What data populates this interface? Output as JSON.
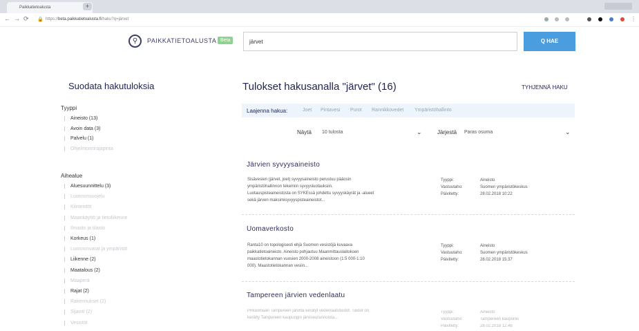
{
  "browser": {
    "tab_title": "Paikkatietoalusta",
    "url_host": "beta.paikkatietoalusta.fi",
    "url_prefix": "https://",
    "url_path": "/haku?q=järvet"
  },
  "header": {
    "logo_text": "PAIKKATIETOALUSTA",
    "beta_label": "Beta",
    "search_value": "järvet",
    "search_button": "Q HAE"
  },
  "filters": {
    "title": "Suodata hakutuloksia",
    "type_group": {
      "label": "Tyyppi",
      "items": [
        {
          "label": "Aineisto (13)",
          "faded": false
        },
        {
          "label": "Avoin data (3)",
          "faded": false
        },
        {
          "label": "Palvelu (1)",
          "faded": false
        },
        {
          "label": "Ohjelmointirajapinta",
          "faded": true
        }
      ]
    },
    "topic_group": {
      "label": "Aihealue",
      "items": [
        {
          "label": "Aluesuunnittelu (3)",
          "faded": false
        },
        {
          "label": "Luonnonsuojelu",
          "faded": true
        },
        {
          "label": "Kiinteistöt",
          "faded": true
        },
        {
          "label": "Maankäyttö ja tietoliikenne",
          "faded": true
        },
        {
          "label": "Ilmasto ja tilasto",
          "faded": true
        },
        {
          "label": "Korkeus (1)",
          "faded": false
        },
        {
          "label": "Luonnonvarat ja ympäristö",
          "faded": true
        },
        {
          "label": "Liikenne (2)",
          "faded": false
        },
        {
          "label": "Maatalous (2)",
          "faded": false
        },
        {
          "label": "Maaperä",
          "faded": true
        },
        {
          "label": "Rajat (2)",
          "faded": false
        },
        {
          "label": "Rakennukset (2)",
          "faded": true
        },
        {
          "label": "Sijainti (2)",
          "faded": true
        },
        {
          "label": "Vesistöt",
          "faded": true
        }
      ]
    }
  },
  "results": {
    "title": "Tulokset hakusanalla \"järvet\" (16)",
    "clear_label": "TYHJENNÄ HAKU",
    "expand_label": "Laajenna hakua:",
    "expand_chips": [
      "Joet",
      "Pintavesi",
      "Purot",
      "Rannikkovedet",
      "Ympäristöhallinto"
    ],
    "show_label": "Näytä",
    "show_value": "10 tulosta",
    "sort_label": "Järjestä",
    "sort_value": "Paras osuma",
    "meta_keys": {
      "type": "Tyyppi:",
      "owner": "Vastuutaho:",
      "updated": "Päivitetty:"
    },
    "cards": [
      {
        "title": "Järvien syvyysaineisto",
        "desc": [
          "Sisävesien (järvet, joet) syvyysaineisto perustuu pääosin",
          "ympäristöhallinnon tekemiin syvyysluotauksiin.",
          "Luotauspisteaineistosta on SYKEssä johdettu syvyyskäyrät ja -alueet",
          "sekä järven maksimisyvyyspisteaineistot..."
        ],
        "type": "Aineisto",
        "owner": "Suomen ympäristökeskus",
        "updated": "28.02.2018 10:22"
      },
      {
        "title": "Uomaverkosto",
        "desc": [
          "Ranta10 on topologisesti ehjä Suomen vesistöjä kuvaava",
          "paikkatietoaineisto. Aineisto pohjautuu Maanmittauslaitoksen",
          "maastotietokannan vuosien 2000-2008 aineistoon (1:5 000-1:10",
          "000). Maastotietokannan vesiin..."
        ],
        "type": "Aineisto",
        "owner": "Suomen ympäristökeskus",
        "updated": "28.02.2018 15.37"
      },
      {
        "title": "Tampereen järvien vedenlaatu",
        "desc": [
          "Pirkanmaan Tampereen järviltä kerätyt vedenlaatutiedot. Tiedot on",
          "kerätty Tampereen kaupungin järviseurannoista..."
        ],
        "type": "Aineisto",
        "owner": "Tampereen kaupunki",
        "updated": "28.02.2018 12.48"
      }
    ]
  }
}
